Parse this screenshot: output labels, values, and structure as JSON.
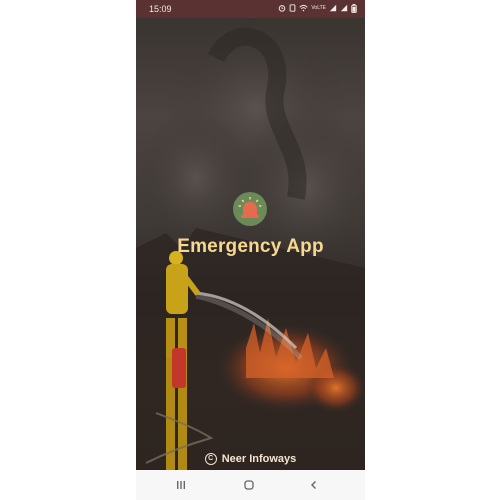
{
  "status_bar": {
    "time": "15:09",
    "icons": [
      "alarm-icon",
      "notification-icon",
      "wifi-icon",
      "volte-icon",
      "signal-icon",
      "signal-icon",
      "battery-icon"
    ],
    "volte_label": "VoLTE"
  },
  "app": {
    "title": "Emergency App",
    "credit": "Neer Infoways",
    "logo_icon": "siren-icon",
    "colors": {
      "title": "#f7d88f",
      "logo_bg": "#6a8a57",
      "siren": "#e56b4f",
      "status_bar": "#5a3232"
    }
  },
  "nav": {
    "buttons": [
      "recent-apps-icon",
      "home-icon",
      "back-icon"
    ]
  }
}
